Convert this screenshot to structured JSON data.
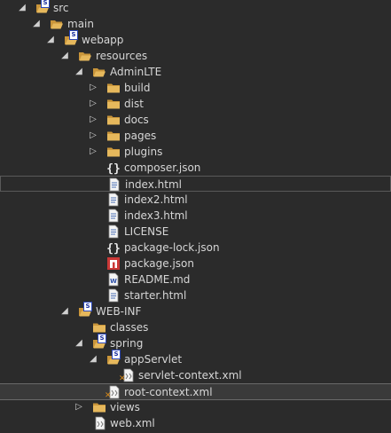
{
  "colors": {
    "background": "#2b2b2b",
    "text": "#d6d6d6",
    "folder": "#e6b85c",
    "selection": "#3a3a3a",
    "npm_red": "#cb3837"
  },
  "tree": [
    {
      "label": "src",
      "indent": 0,
      "expanded": true,
      "icon": "folder-open-icon",
      "badge": "S"
    },
    {
      "label": "main",
      "indent": 1,
      "expanded": true,
      "icon": "folder-open-icon"
    },
    {
      "label": "webapp",
      "indent": 2,
      "expanded": true,
      "icon": "folder-open-icon",
      "badge": "S"
    },
    {
      "label": "resources",
      "indent": 3,
      "expanded": true,
      "icon": "folder-open-icon"
    },
    {
      "label": "AdminLTE",
      "indent": 4,
      "expanded": true,
      "icon": "folder-open-icon"
    },
    {
      "label": "build",
      "indent": 5,
      "expanded": false,
      "icon": "folder-icon"
    },
    {
      "label": "dist",
      "indent": 5,
      "expanded": false,
      "icon": "folder-icon"
    },
    {
      "label": "docs",
      "indent": 5,
      "expanded": false,
      "icon": "folder-icon"
    },
    {
      "label": "pages",
      "indent": 5,
      "expanded": false,
      "icon": "folder-icon"
    },
    {
      "label": "plugins",
      "indent": 5,
      "expanded": false,
      "icon": "folder-icon"
    },
    {
      "label": "composer.json",
      "indent": 5,
      "icon": "json-file-icon"
    },
    {
      "label": "index.html",
      "indent": 5,
      "icon": "html-file-icon",
      "outlined": true
    },
    {
      "label": "index2.html",
      "indent": 5,
      "icon": "html-file-icon"
    },
    {
      "label": "index3.html",
      "indent": 5,
      "icon": "html-file-icon"
    },
    {
      "label": "LICENSE",
      "indent": 5,
      "icon": "text-file-icon"
    },
    {
      "label": "package-lock.json",
      "indent": 5,
      "icon": "json-file-icon"
    },
    {
      "label": "package.json",
      "indent": 5,
      "icon": "npm-file-icon"
    },
    {
      "label": "README.md",
      "indent": 5,
      "icon": "markdown-file-icon"
    },
    {
      "label": "starter.html",
      "indent": 5,
      "icon": "html-file-icon"
    },
    {
      "label": "WEB-INF",
      "indent": 3,
      "expanded": true,
      "icon": "folder-open-icon",
      "badge": "S"
    },
    {
      "label": "classes",
      "indent": 4,
      "icon": "folder-icon"
    },
    {
      "label": "spring",
      "indent": 4,
      "expanded": true,
      "icon": "folder-open-icon",
      "badge": "S"
    },
    {
      "label": "appServlet",
      "indent": 5,
      "expanded": true,
      "icon": "folder-open-icon",
      "badge": "S"
    },
    {
      "label": "servlet-context.xml",
      "indent": 6,
      "icon": "spring-xml-file-icon"
    },
    {
      "label": "root-context.xml",
      "indent": 5,
      "icon": "spring-xml-file-icon",
      "selected": true
    },
    {
      "label": "views",
      "indent": 4,
      "expanded": false,
      "icon": "folder-icon"
    },
    {
      "label": "web.xml",
      "indent": 4,
      "icon": "xml-file-icon"
    }
  ]
}
